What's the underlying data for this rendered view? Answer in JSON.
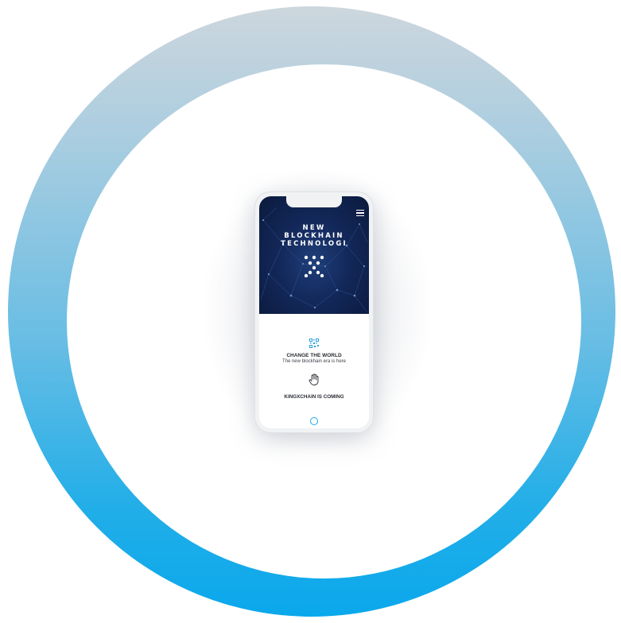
{
  "colors": {
    "ring_top": "#cdd6dd",
    "ring_bottom": "#0aa8ec",
    "hero_bg": "#13285a",
    "accent": "#1aa8e6"
  },
  "hero": {
    "title_line1": "NEW",
    "title_line2": "BLOCKHAIN",
    "title_line3": "TECHNOLOGI",
    "menu_icon": "hamburger-menu-icon",
    "logo_icon": "kingxchain-logo-dots"
  },
  "content": {
    "qr_icon": "qr-code-icon",
    "headline": "CHANGE THE WORLD",
    "subline": "The new blockhain era is here",
    "hand_icon": "hand-icon",
    "coming": "KINGXCHAIN IS COMING"
  },
  "device": {
    "home_button_icon": "home-circle-icon"
  }
}
